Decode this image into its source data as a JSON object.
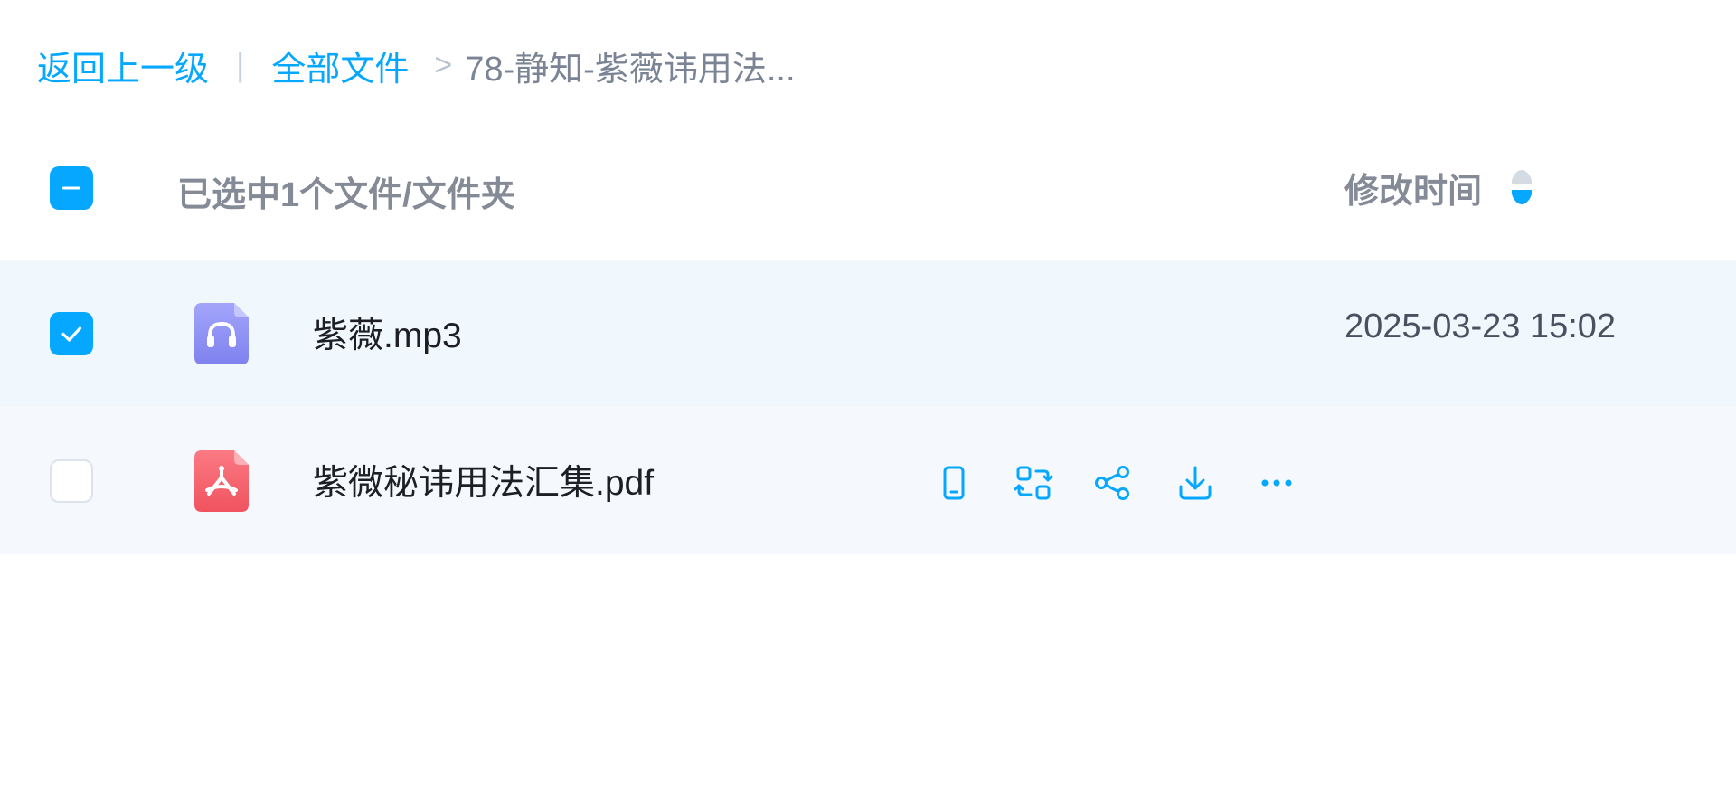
{
  "breadcrumb": {
    "back_label": "返回上一级",
    "separator": "|",
    "root_label": "全部文件",
    "arrow": ">",
    "current_label": "78-静知-紫薇讳用法..."
  },
  "header": {
    "selection_text": "已选中1个文件/文件夹",
    "time_column_label": "修改时间",
    "select_all_state": "partial"
  },
  "files": [
    {
      "name": "紫薇.mp3",
      "type": "audio",
      "icon": "audio-file-icon",
      "modified": "2025-03-23 15:02",
      "checked": true
    },
    {
      "name": "紫微秘讳用法汇集.pdf",
      "type": "pdf",
      "icon": "pdf-file-icon",
      "modified": "",
      "checked": false,
      "hover_actions": [
        "phone-icon",
        "convert-icon",
        "share-icon",
        "download-icon",
        "more-icon"
      ]
    }
  ],
  "colors": {
    "accent": "#06a7ff",
    "audio_icon": "#8c8ef5",
    "pdf_icon": "#f6626f",
    "selected_row_bg": "#f0f8fe",
    "hover_row_bg": "#f5f8fc"
  }
}
